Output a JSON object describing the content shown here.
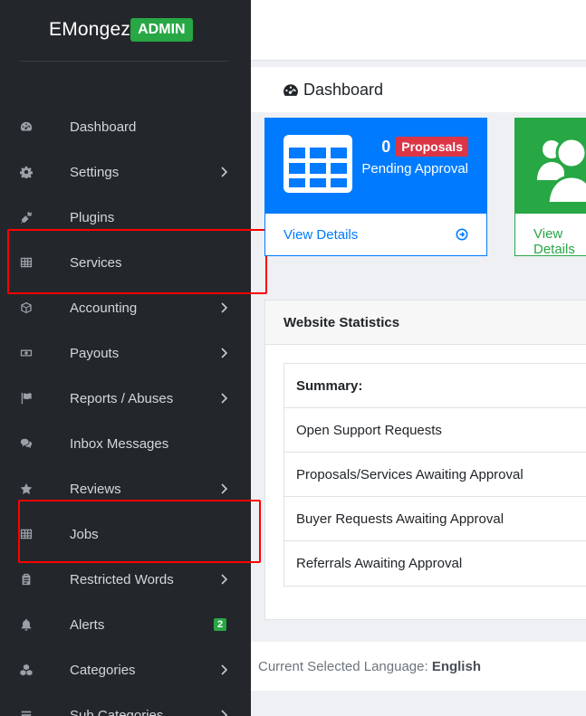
{
  "brand": {
    "name": "EMongez",
    "badge": "ADMIN"
  },
  "sidebar": {
    "items": [
      {
        "label": "Dashboard",
        "icon": "tachometer-icon",
        "chevron": false
      },
      {
        "label": "Settings",
        "icon": "cog-icon",
        "chevron": true
      },
      {
        "label": "Plugins",
        "icon": "plug-icon",
        "chevron": false
      },
      {
        "label": "Services",
        "icon": "table-icon",
        "chevron": false
      },
      {
        "label": "Accounting",
        "icon": "cube-icon",
        "chevron": true
      },
      {
        "label": "Payouts",
        "icon": "money-icon",
        "chevron": true
      },
      {
        "label": "Reports / Abuses",
        "icon": "flag-icon",
        "chevron": true
      },
      {
        "label": "Inbox Messages",
        "icon": "comments-icon",
        "chevron": false
      },
      {
        "label": "Reviews",
        "icon": "star-icon",
        "chevron": true
      },
      {
        "label": "Jobs",
        "icon": "table-icon",
        "chevron": false
      },
      {
        "label": "Restricted Words",
        "icon": "clipboard-icon",
        "chevron": true
      },
      {
        "label": "Alerts",
        "icon": "bell-icon",
        "chevron": false,
        "badge": "2"
      },
      {
        "label": "Categories",
        "icon": "cubes-icon",
        "chevron": true
      },
      {
        "label": "Sub Categories",
        "icon": "list-icon",
        "chevron": true
      }
    ]
  },
  "header": {
    "title": "Dashboard"
  },
  "cards": {
    "proposals": {
      "count": "0",
      "tag": "Proposals",
      "subtitle": "Pending Approval",
      "link": "View Details"
    },
    "users": {
      "link": "View Details"
    }
  },
  "stats": {
    "title": "Website Statistics",
    "summary_label": "Summary:",
    "rows": [
      "Open Support Requests",
      "Proposals/Services Awaiting Approval",
      "Buyer Requests Awaiting Approval",
      "Referrals Awaiting Approval"
    ]
  },
  "footer": {
    "label": "Current Selected Language:",
    "value": "English"
  },
  "colors": {
    "sidebar": "#23272b",
    "primary": "#007bff",
    "success": "#28a745",
    "danger": "#dc3545",
    "highlight": "#ff0000"
  }
}
